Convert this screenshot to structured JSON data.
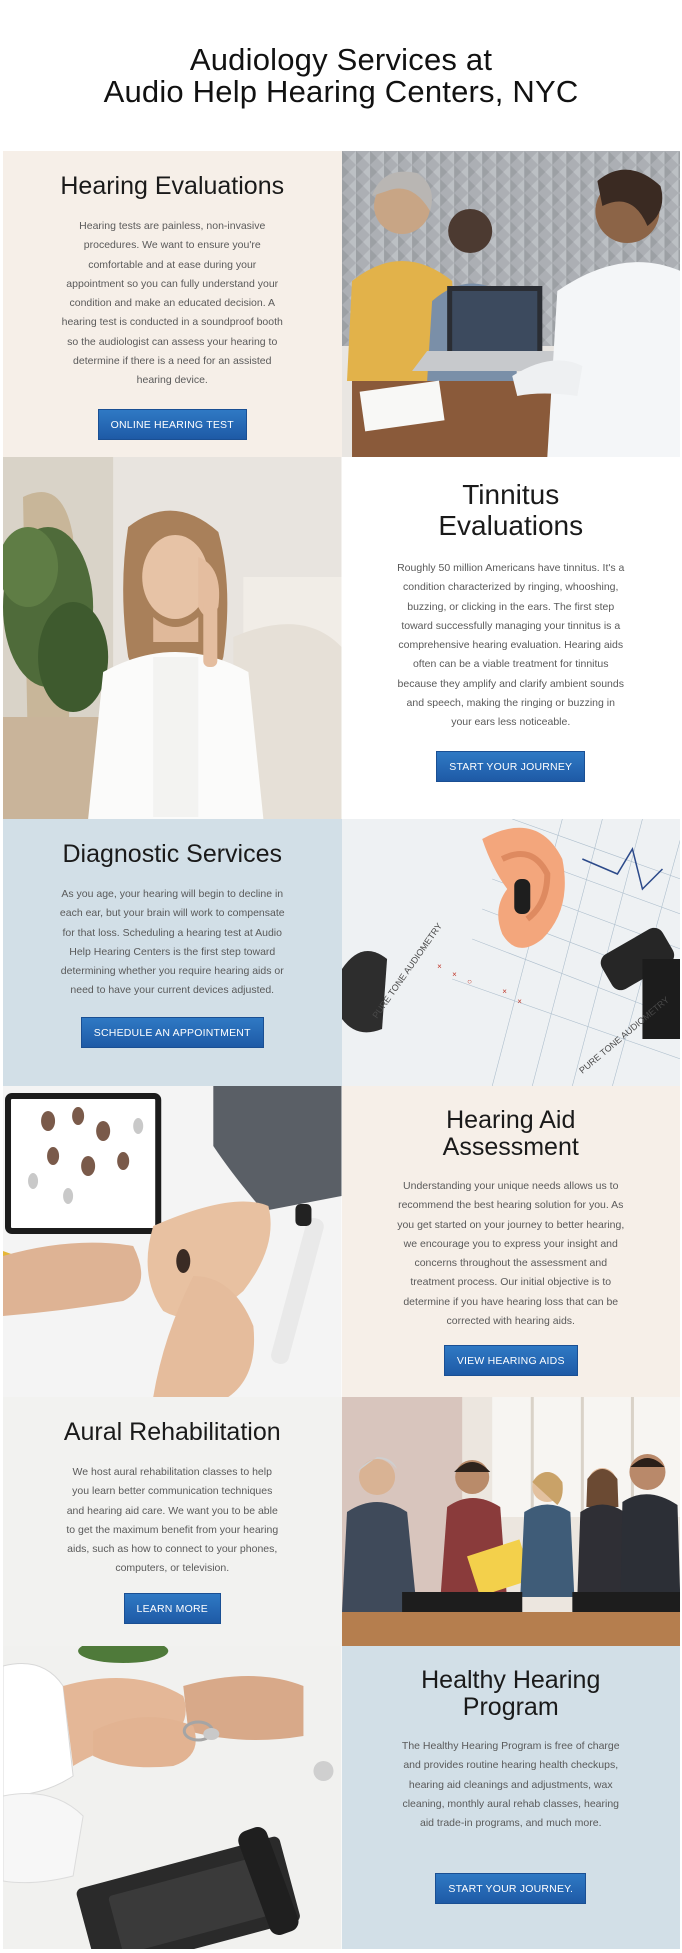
{
  "header": {
    "title_line1": "Audiology Services at",
    "title_line2": "Audio Help Hearing Centers, NYC"
  },
  "sections": [
    {
      "title": "Hearing Evaluations",
      "body": "Hearing tests are painless, non-invasive procedures. We want to ensure you're comfortable and at ease during your appointment so you can fully understand your condition and make an educated decision. A hearing test is conducted in a soundproof booth so the audiologist can assess your hearing to determine if there is a need for an assisted hearing device.",
      "button": "ONLINE HEARING TEST",
      "image": "audiologist-performing-hearing-test-photo"
    },
    {
      "title_line1": "Tinnitus",
      "title_line2": "Evaluations",
      "body": "Roughly 50 million Americans have tinnitus. It's a condition characterized by ringing, whooshing, buzzing, or clicking in the ears. The first step toward successfully managing your tinnitus is a comprehensive hearing evaluation. Hearing aids often can be a viable treatment for tinnitus because they amplify and clarify ambient sounds and speech, making the ringing or buzzing in your ears less noticeable.",
      "button": "START YOUR JOURNEY",
      "image": "woman-holding-ear-photo"
    },
    {
      "title": "Diagnostic Services",
      "body": "As you age, your hearing will begin to decline in each ear, but your brain will work to compensate for that loss. Scheduling a hearing test at Audio Help Hearing Centers is the first step toward determining whether you require hearing aids or need to have your current devices adjusted.",
      "button": "SCHEDULE AN APPOINTMENT",
      "image": "ear-model-audiogram-otoscope-photo"
    },
    {
      "title_line1": "Hearing Aid",
      "title_line2": "Assessment",
      "body": "Understanding your unique needs allows us to recommend the best hearing solution for you. As you get started on your journey to better hearing, we encourage you to express your insight and concerns throughout the assessment and treatment process. Our initial objective is to determine if you have hearing loss that can be corrected with hearing aids.",
      "button": "VIEW HEARING AIDS",
      "image": "hands-holding-hearing-aid-photo"
    },
    {
      "title": "Aural Rehabilitation",
      "body": "We host aural rehabilitation classes to help you learn better communication techniques and hearing aid care. We want you to be able to get the maximum benefit from your hearing aids, such as how to connect to your phones, computers, or television.",
      "button": "LEARN MORE",
      "image": "group-class-discussion-photo"
    },
    {
      "title_line1": "Healthy Hearing",
      "title_line2": "Program",
      "body": "The Healthy Hearing Program is free of charge and provides routine hearing health checkups, hearing aid cleanings and adjustments, wax cleaning, monthly aural rehab classes, hearing aid trade-in programs, and much more.",
      "button": "START YOUR JOURNEY.",
      "image": "hands-passing-hearing-aid-photo"
    }
  ],
  "colors": {
    "button": "#1e5aa6",
    "beige": "#f6efe8",
    "blue": "#d2dfe7",
    "grey": "#f2f2f0"
  }
}
